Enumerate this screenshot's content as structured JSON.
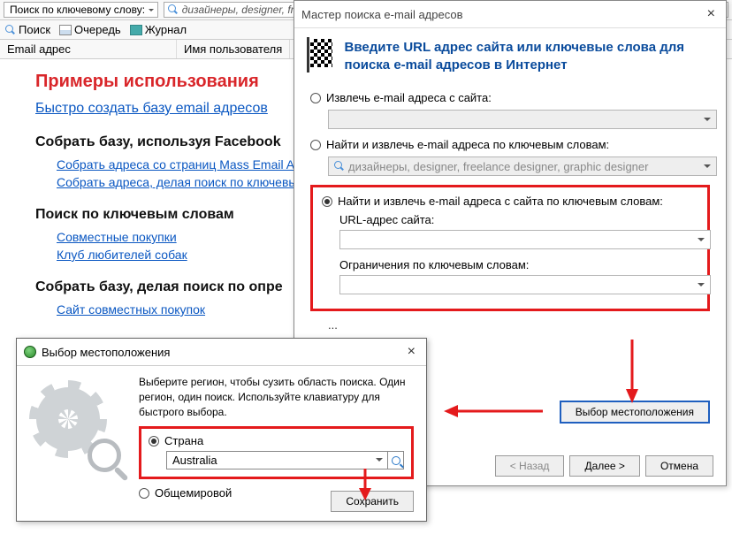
{
  "toolbar": {
    "mode_label": "Поиск по ключевому слову:",
    "search_placeholder": "дизайнеры, designer, fr"
  },
  "tabs": {
    "search": "Поиск",
    "queue": "Очередь",
    "journal": "Журнал"
  },
  "columns": {
    "email": "Email адрес",
    "username": "Имя пользователя"
  },
  "examples": {
    "title": "Примеры использования",
    "quick_base": "Быстро создать базу email адресов",
    "facebook_h": "Собрать базу, используя Facebook",
    "fb1": "Собрать адреса со страниц Mass Email Add",
    "fb2": "Собрать адреса, делая поиск по ключевым",
    "keywords_h": "Поиск по ключевым словам",
    "kw1": "Совместные покупки",
    "kw2": "Клуб любителей собак",
    "opred_h": "Собрать базу, делая поиск по опре",
    "opred1": "Сайт совместных покупок"
  },
  "wizard": {
    "title": "Мастер поиска e-mail адресов",
    "heading": "Введите URL адрес сайта или ключевые слова для поиска e-mail адресов в Интернет",
    "r1": "Извлечь e-mail адреса с сайта:",
    "r2": "Найти и извлечь e-mail адреса по ключевым словам:",
    "kw_placeholder": "дизайнеры, designer, freelance designer, graphic designer",
    "r3": "Найти и извлечь e-mail адреса с сайта по ключевым словам:",
    "url_label": "URL-адрес сайта:",
    "restrict_label": "Ограничения по ключевым словам:",
    "loc_dots": "...",
    "loc_btn": "Выбор местоположения",
    "back": "< Назад",
    "next": "Далее >",
    "cancel": "Отмена"
  },
  "loc": {
    "title": "Выбор местоположения",
    "desc": "Выберите регион, чтобы сузить область поиска. Один регион, один поиск. Используйте клавиатуру для быстрого выбора.",
    "r_country": "Страна",
    "country_val": "Australia",
    "r_world": "Общемировой",
    "save": "Сохранить"
  }
}
